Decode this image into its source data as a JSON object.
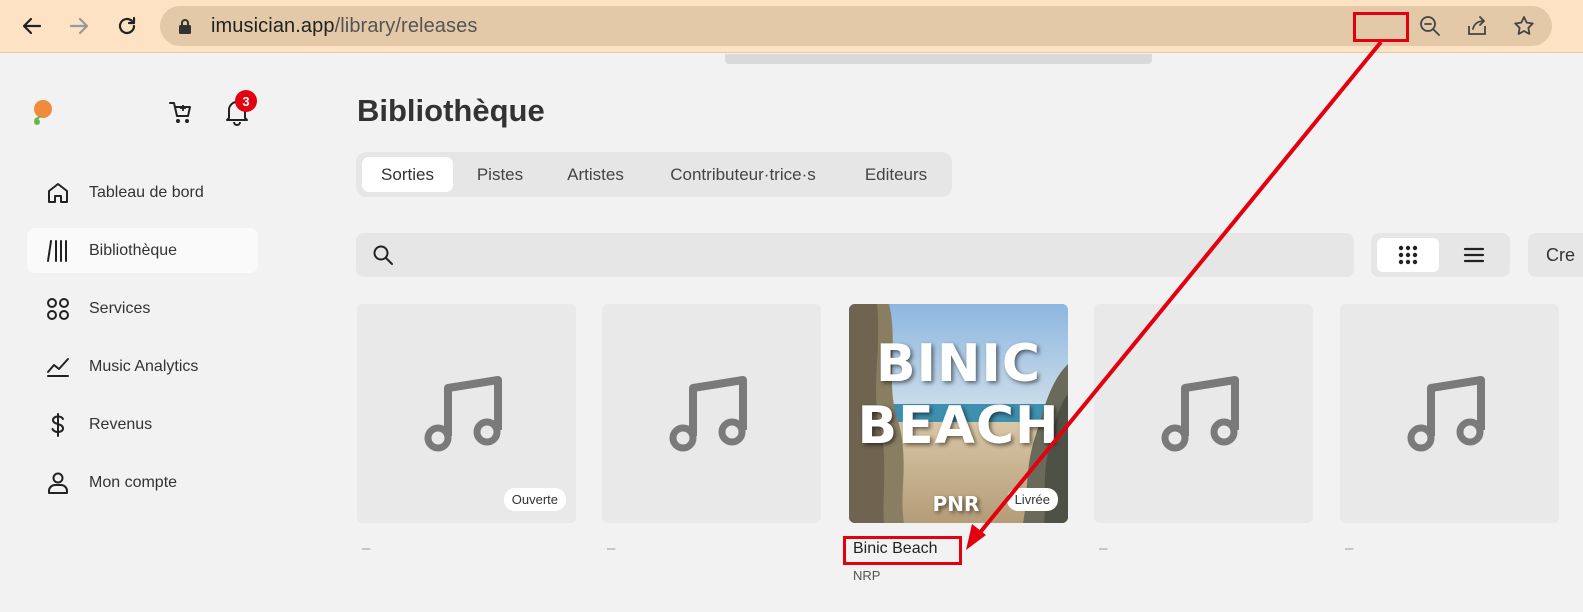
{
  "browser": {
    "url_host": "imusician.app",
    "url_path": "/library/releases"
  },
  "sidebar": {
    "notifications_count": "3",
    "items": [
      {
        "label": "Tableau de bord",
        "icon": "home-icon"
      },
      {
        "label": "Bibliothèque",
        "icon": "library-icon",
        "active": true
      },
      {
        "label": "Services",
        "icon": "services-icon"
      },
      {
        "label": "Music Analytics",
        "icon": "analytics-icon"
      },
      {
        "label": "Revenus",
        "icon": "dollar-icon"
      },
      {
        "label": "Mon compte",
        "icon": "user-icon"
      }
    ]
  },
  "main": {
    "title": "Bibliothèque",
    "tabs": [
      {
        "label": "Sorties",
        "active": true
      },
      {
        "label": "Pistes"
      },
      {
        "label": "Artistes"
      },
      {
        "label": "Contributeur·trice·s"
      },
      {
        "label": "Editeurs"
      }
    ],
    "create_label": "Cre",
    "releases": [
      {
        "title": "–",
        "subtitle": "",
        "status": "Ouverte",
        "cover": "music-note-icon"
      },
      {
        "title": "–",
        "subtitle": "",
        "status": "",
        "cover": "music-note-icon"
      },
      {
        "title": "Binic Beach",
        "subtitle": "NRP",
        "status": "Livrée",
        "cover": "cover-image",
        "cover_text": [
          "BINIC",
          "BEACH",
          "PNR"
        ]
      },
      {
        "title": "–",
        "subtitle": "",
        "status": "",
        "cover": "music-note-icon"
      },
      {
        "title": "–",
        "subtitle": "",
        "status": "",
        "cover": "music-note-icon"
      }
    ]
  },
  "annotation": {
    "highlight_color": "#e3000f"
  }
}
